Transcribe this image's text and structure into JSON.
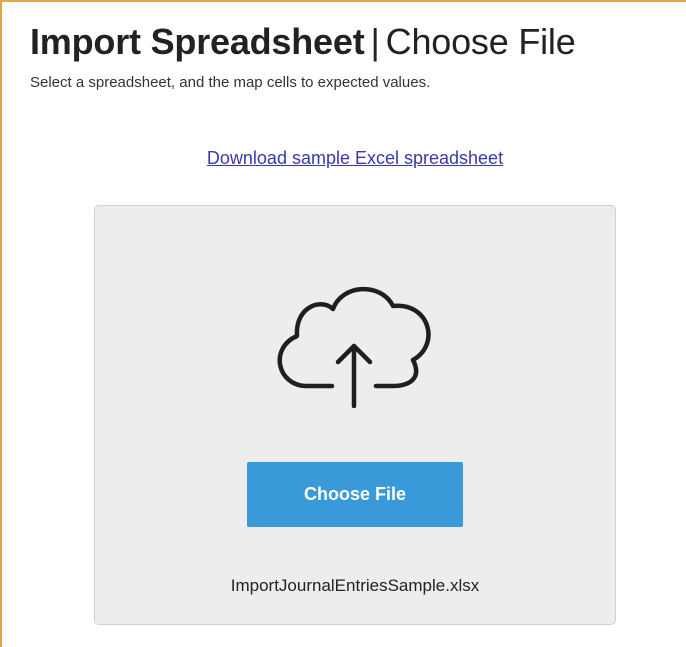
{
  "header": {
    "title_main": "Import Spreadsheet",
    "title_separator": "|",
    "title_sub": "Choose File",
    "subtitle": "Select a spreadsheet, and the map cells to expected values."
  },
  "links": {
    "download_sample": "Download sample Excel spreadsheet"
  },
  "upload": {
    "icon": "cloud-upload-icon",
    "button_label": "Choose File",
    "selected_file": "ImportJournalEntriesSample.xlsx"
  },
  "colors": {
    "frame_border": "#e0a64a",
    "link": "#3a3aa8",
    "button_bg": "#3a9ad9",
    "drop_zone_bg": "#ededed"
  }
}
